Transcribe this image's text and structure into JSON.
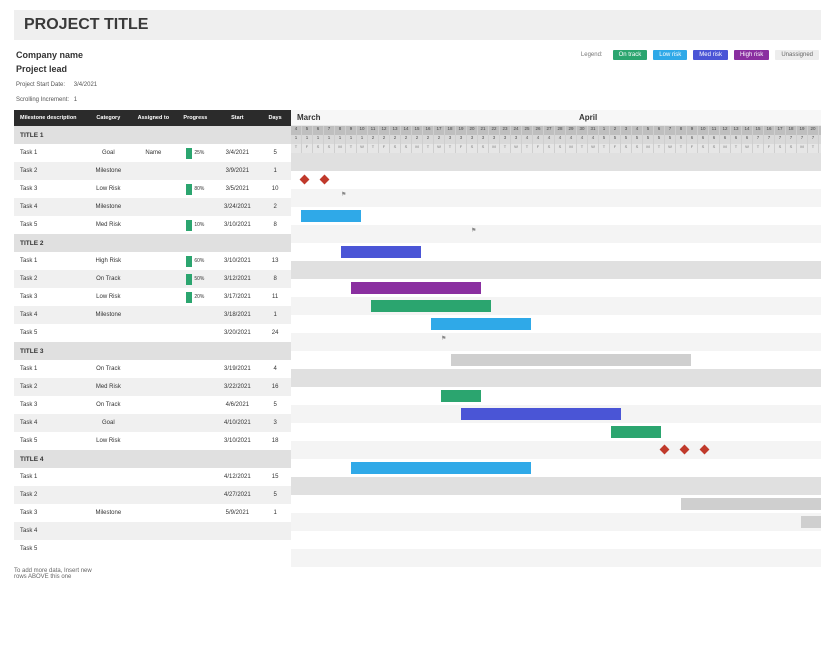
{
  "header": {
    "project_title": "PROJECT TITLE",
    "company_name": "Company name",
    "project_lead": "Project lead",
    "start_date_label": "Project Start Date:",
    "start_date": "3/4/2021",
    "scroll_label": "Scrolling Increment:",
    "scroll": "1"
  },
  "legend": {
    "label": "Legend:",
    "items": [
      {
        "label": "On track",
        "cls": "p-ontrack"
      },
      {
        "label": "Low risk",
        "cls": "p-low"
      },
      {
        "label": "Med risk",
        "cls": "p-med"
      },
      {
        "label": "High risk",
        "cls": "p-high"
      },
      {
        "label": "Unassigned",
        "cls": "p-una"
      }
    ]
  },
  "columns": {
    "desc": "Milestone description",
    "cat": "Category",
    "asg": "Assigned to",
    "prog": "Progress",
    "start": "Start",
    "days": "Days"
  },
  "months": {
    "m1": "March",
    "m2": "April"
  },
  "rows": [
    {
      "type": "section",
      "desc": "TITLE 1"
    },
    {
      "type": "task",
      "desc": "Task 1",
      "cat": "Goal",
      "asg": "Name",
      "prog": "25%",
      "start": "3/4/2021",
      "days": "5",
      "bars": [],
      "diamonds": [
        1,
        3
      ]
    },
    {
      "type": "task",
      "desc": "Task 2",
      "cat": "Milestone",
      "asg": "",
      "prog": "",
      "start": "3/9/2021",
      "days": "1",
      "flag": 5
    },
    {
      "type": "task",
      "desc": "Task 3",
      "cat": "Low Risk",
      "asg": "",
      "prog": "80%",
      "start": "3/5/2021",
      "days": "10",
      "bars": [
        {
          "x": 1,
          "w": 6,
          "c": "b-blue"
        }
      ]
    },
    {
      "type": "task",
      "desc": "Task 4",
      "cat": "Milestone",
      "asg": "",
      "prog": "",
      "start": "3/24/2021",
      "days": "2",
      "flag": 18
    },
    {
      "type": "task",
      "desc": "Task 5",
      "cat": "Med Risk",
      "asg": "",
      "prog": "10%",
      "start": "3/10/2021",
      "days": "8",
      "bars": [
        {
          "x": 5,
          "w": 8,
          "c": "b-navy"
        }
      ]
    },
    {
      "type": "section",
      "desc": "TITLE 2"
    },
    {
      "type": "task",
      "desc": "Task 1",
      "cat": "High Risk",
      "asg": "",
      "prog": "60%",
      "start": "3/10/2021",
      "days": "13",
      "bars": [
        {
          "x": 6,
          "w": 13,
          "c": "b-purple"
        }
      ]
    },
    {
      "type": "task",
      "desc": "Task 2",
      "cat": "On Track",
      "asg": "",
      "prog": "50%",
      "start": "3/12/2021",
      "days": "8",
      "bars": [
        {
          "x": 8,
          "w": 12,
          "c": "b-green"
        }
      ]
    },
    {
      "type": "task",
      "desc": "Task 3",
      "cat": "Low Risk",
      "asg": "",
      "prog": "20%",
      "start": "3/17/2021",
      "days": "11",
      "bars": [
        {
          "x": 14,
          "w": 10,
          "c": "b-blue"
        }
      ]
    },
    {
      "type": "task",
      "desc": "Task 4",
      "cat": "Milestone",
      "asg": "",
      "prog": "",
      "start": "3/18/2021",
      "days": "1",
      "flag": 15
    },
    {
      "type": "task",
      "desc": "Task 5",
      "cat": "",
      "asg": "",
      "prog": "",
      "start": "3/20/2021",
      "days": "24",
      "bars": [
        {
          "x": 16,
          "w": 24,
          "c": "b-grey"
        }
      ]
    },
    {
      "type": "section",
      "desc": "TITLE 3"
    },
    {
      "type": "task",
      "desc": "Task 1",
      "cat": "On Track",
      "asg": "",
      "prog": "",
      "start": "3/19/2021",
      "days": "4",
      "bars": [
        {
          "x": 15,
          "w": 4,
          "c": "b-green"
        }
      ]
    },
    {
      "type": "task",
      "desc": "Task 2",
      "cat": "Med Risk",
      "asg": "",
      "prog": "",
      "start": "3/22/2021",
      "days": "16",
      "bars": [
        {
          "x": 17,
          "w": 16,
          "c": "b-navy"
        }
      ]
    },
    {
      "type": "task",
      "desc": "Task 3",
      "cat": "On Track",
      "asg": "",
      "prog": "",
      "start": "4/6/2021",
      "days": "5",
      "bars": [
        {
          "x": 32,
          "w": 5,
          "c": "b-green"
        }
      ]
    },
    {
      "type": "task",
      "desc": "Task 4",
      "cat": "Goal",
      "asg": "",
      "prog": "",
      "start": "4/10/2021",
      "days": "3",
      "diamonds": [
        37,
        39,
        41
      ]
    },
    {
      "type": "task",
      "desc": "Task 5",
      "cat": "Low Risk",
      "asg": "",
      "prog": "",
      "start": "3/10/2021",
      "days": "18",
      "bars": [
        {
          "x": 6,
          "w": 18,
          "c": "b-blue"
        }
      ]
    },
    {
      "type": "section",
      "desc": "TITLE 4"
    },
    {
      "type": "task",
      "desc": "Task 1",
      "cat": "",
      "asg": "",
      "prog": "",
      "start": "4/12/2021",
      "days": "15",
      "bars": [
        {
          "x": 39,
          "w": 14,
          "c": "b-grey"
        }
      ]
    },
    {
      "type": "task",
      "desc": "Task 2",
      "cat": "",
      "asg": "",
      "prog": "",
      "start": "4/27/2021",
      "days": "5",
      "bars": [
        {
          "x": 51,
          "w": 4,
          "c": "b-grey"
        }
      ]
    },
    {
      "type": "task",
      "desc": "Task 3",
      "cat": "Milestone",
      "asg": "",
      "prog": "",
      "start": "5/9/2021",
      "days": "1"
    },
    {
      "type": "task",
      "desc": "Task 4"
    },
    {
      "type": "task",
      "desc": "Task 5"
    }
  ],
  "footnote": "To add more data, Insert new\nrows ABOVE this one",
  "chart_data": {
    "type": "gantt",
    "title": "PROJECT TITLE",
    "timeline_start": "2021-03-04",
    "x_unit": "days",
    "xlabel_months": [
      "March",
      "April"
    ],
    "legend": [
      "On track",
      "Low risk",
      "Med risk",
      "High risk",
      "Unassigned"
    ],
    "groups": [
      {
        "name": "TITLE 1",
        "tasks": [
          {
            "name": "Task 1",
            "category": "Goal",
            "assigned": "Name",
            "progress": 25,
            "start": "2021-03-04",
            "days": 5,
            "markers": [
              "milestone",
              "milestone"
            ]
          },
          {
            "name": "Task 2",
            "category": "Milestone",
            "start": "2021-03-09",
            "days": 1
          },
          {
            "name": "Task 3",
            "category": "Low Risk",
            "progress": 80,
            "start": "2021-03-05",
            "days": 10
          },
          {
            "name": "Task 4",
            "category": "Milestone",
            "start": "2021-03-24",
            "days": 2
          },
          {
            "name": "Task 5",
            "category": "Med Risk",
            "progress": 10,
            "start": "2021-03-10",
            "days": 8
          }
        ]
      },
      {
        "name": "TITLE 2",
        "tasks": [
          {
            "name": "Task 1",
            "category": "High Risk",
            "progress": 60,
            "start": "2021-03-10",
            "days": 13
          },
          {
            "name": "Task 2",
            "category": "On Track",
            "progress": 50,
            "start": "2021-03-12",
            "days": 8
          },
          {
            "name": "Task 3",
            "category": "Low Risk",
            "progress": 20,
            "start": "2021-03-17",
            "days": 11
          },
          {
            "name": "Task 4",
            "category": "Milestone",
            "start": "2021-03-18",
            "days": 1
          },
          {
            "name": "Task 5",
            "category": "Unassigned",
            "start": "2021-03-20",
            "days": 24
          }
        ]
      },
      {
        "name": "TITLE 3",
        "tasks": [
          {
            "name": "Task 1",
            "category": "On Track",
            "start": "2021-03-19",
            "days": 4
          },
          {
            "name": "Task 2",
            "category": "Med Risk",
            "start": "2021-03-22",
            "days": 16
          },
          {
            "name": "Task 3",
            "category": "On Track",
            "start": "2021-04-06",
            "days": 5
          },
          {
            "name": "Task 4",
            "category": "Goal",
            "start": "2021-04-10",
            "days": 3,
            "markers": [
              "milestone",
              "milestone",
              "milestone"
            ]
          },
          {
            "name": "Task 5",
            "category": "Low Risk",
            "start": "2021-03-10",
            "days": 18
          }
        ]
      },
      {
        "name": "TITLE 4",
        "tasks": [
          {
            "name": "Task 1",
            "category": "Unassigned",
            "start": "2021-04-12",
            "days": 15
          },
          {
            "name": "Task 2",
            "category": "Unassigned",
            "start": "2021-04-27",
            "days": 5
          },
          {
            "name": "Task 3",
            "category": "Milestone",
            "start": "2021-05-09",
            "days": 1
          },
          {
            "name": "Task 4"
          },
          {
            "name": "Task 5"
          }
        ]
      }
    ]
  }
}
